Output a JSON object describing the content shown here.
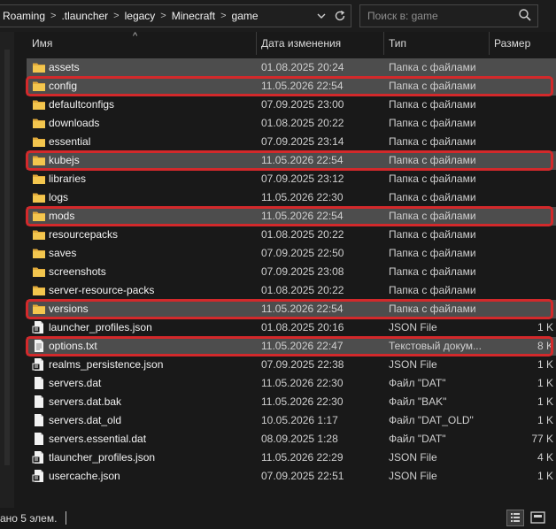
{
  "breadcrumb": {
    "items": [
      "Roaming",
      ".tlauncher",
      "legacy",
      "Minecraft",
      "game"
    ],
    "separator": ">"
  },
  "address_controls": {
    "dropdown_icon": "chevron-down-icon",
    "refresh_icon": "refresh-icon"
  },
  "search": {
    "placeholder": "Поиск в: game",
    "icon": "search-icon"
  },
  "columns": {
    "name": "Имя",
    "date": "Дата изменения",
    "type": "Тип",
    "size": "Размер"
  },
  "sort": {
    "column": "name",
    "indicator": "^"
  },
  "files": [
    {
      "name": "assets",
      "date": "01.08.2025 20:24",
      "type": "Папка с файлами",
      "size": "",
      "icon": "folder-icon",
      "selected": true,
      "highlighted": false
    },
    {
      "name": "config",
      "date": "11.05.2026 22:54",
      "type": "Папка с файлами",
      "size": "",
      "icon": "folder-icon",
      "selected": true,
      "highlighted": true
    },
    {
      "name": "defaultconfigs",
      "date": "07.09.2025 23:00",
      "type": "Папка с файлами",
      "size": "",
      "icon": "folder-icon",
      "selected": false,
      "highlighted": false
    },
    {
      "name": "downloads",
      "date": "01.08.2025 20:22",
      "type": "Папка с файлами",
      "size": "",
      "icon": "folder-icon",
      "selected": false,
      "highlighted": false
    },
    {
      "name": "essential",
      "date": "07.09.2025 23:14",
      "type": "Папка с файлами",
      "size": "",
      "icon": "folder-icon",
      "selected": false,
      "highlighted": false
    },
    {
      "name": "kubejs",
      "date": "11.05.2026 22:54",
      "type": "Папка с файлами",
      "size": "",
      "icon": "folder-icon",
      "selected": true,
      "highlighted": true
    },
    {
      "name": "libraries",
      "date": "07.09.2025 23:12",
      "type": "Папка с файлами",
      "size": "",
      "icon": "folder-icon",
      "selected": false,
      "highlighted": false
    },
    {
      "name": "logs",
      "date": "11.05.2026 22:30",
      "type": "Папка с файлами",
      "size": "",
      "icon": "folder-icon",
      "selected": false,
      "highlighted": false
    },
    {
      "name": "mods",
      "date": "11.05.2026 22:54",
      "type": "Папка с файлами",
      "size": "",
      "icon": "folder-icon",
      "selected": true,
      "highlighted": true
    },
    {
      "name": "resourcepacks",
      "date": "01.08.2025 20:22",
      "type": "Папка с файлами",
      "size": "",
      "icon": "folder-icon",
      "selected": false,
      "highlighted": false
    },
    {
      "name": "saves",
      "date": "07.09.2025 22:50",
      "type": "Папка с файлами",
      "size": "",
      "icon": "folder-icon",
      "selected": false,
      "highlighted": false
    },
    {
      "name": "screenshots",
      "date": "07.09.2025 23:08",
      "type": "Папка с файлами",
      "size": "",
      "icon": "folder-icon",
      "selected": false,
      "highlighted": false
    },
    {
      "name": "server-resource-packs",
      "date": "01.08.2025 20:22",
      "type": "Папка с файлами",
      "size": "",
      "icon": "folder-icon",
      "selected": false,
      "highlighted": false
    },
    {
      "name": "versions",
      "date": "11.05.2026 22:54",
      "type": "Папка с файлами",
      "size": "",
      "icon": "folder-icon",
      "selected": true,
      "highlighted": true
    },
    {
      "name": "launcher_profiles.json",
      "date": "01.08.2025 20:16",
      "type": "JSON File",
      "size": "1 K",
      "icon": "json-file-icon",
      "selected": false,
      "highlighted": false
    },
    {
      "name": "options.txt",
      "date": "11.05.2026 22:47",
      "type": "Текстовый докум...",
      "size": "8 K",
      "icon": "text-file-icon",
      "selected": true,
      "highlighted": true
    },
    {
      "name": "realms_persistence.json",
      "date": "07.09.2025 22:38",
      "type": "JSON File",
      "size": "1 K",
      "icon": "json-file-icon",
      "selected": false,
      "highlighted": false
    },
    {
      "name": "servers.dat",
      "date": "11.05.2026 22:30",
      "type": "Файл \"DAT\"",
      "size": "1 K",
      "icon": "file-icon",
      "selected": false,
      "highlighted": false
    },
    {
      "name": "servers.dat.bak",
      "date": "11.05.2026 22:30",
      "type": "Файл \"BAK\"",
      "size": "1 K",
      "icon": "file-icon",
      "selected": false,
      "highlighted": false
    },
    {
      "name": "servers.dat_old",
      "date": "10.05.2026 1:17",
      "type": "Файл \"DAT_OLD\"",
      "size": "1 K",
      "icon": "file-icon",
      "selected": false,
      "highlighted": false
    },
    {
      "name": "servers.essential.dat",
      "date": "08.09.2025 1:28",
      "type": "Файл \"DAT\"",
      "size": "77 K",
      "icon": "file-icon",
      "selected": false,
      "highlighted": false
    },
    {
      "name": "tlauncher_profiles.json",
      "date": "11.05.2026 22:29",
      "type": "JSON File",
      "size": "4 K",
      "icon": "json-file-icon",
      "selected": false,
      "highlighted": false
    },
    {
      "name": "usercache.json",
      "date": "07.09.2025 22:51",
      "type": "JSON File",
      "size": "1 K",
      "icon": "json-file-icon",
      "selected": false,
      "highlighted": false
    }
  ],
  "status": {
    "text": "ано 5 элем."
  },
  "view_buttons": [
    {
      "name": "details-view-icon",
      "active": true
    },
    {
      "name": "large-icons-view-icon",
      "active": false
    }
  ],
  "colors": {
    "highlight_outline": "#d3292b",
    "selection": "#4d4d4d",
    "folder": "#f3c64e"
  }
}
